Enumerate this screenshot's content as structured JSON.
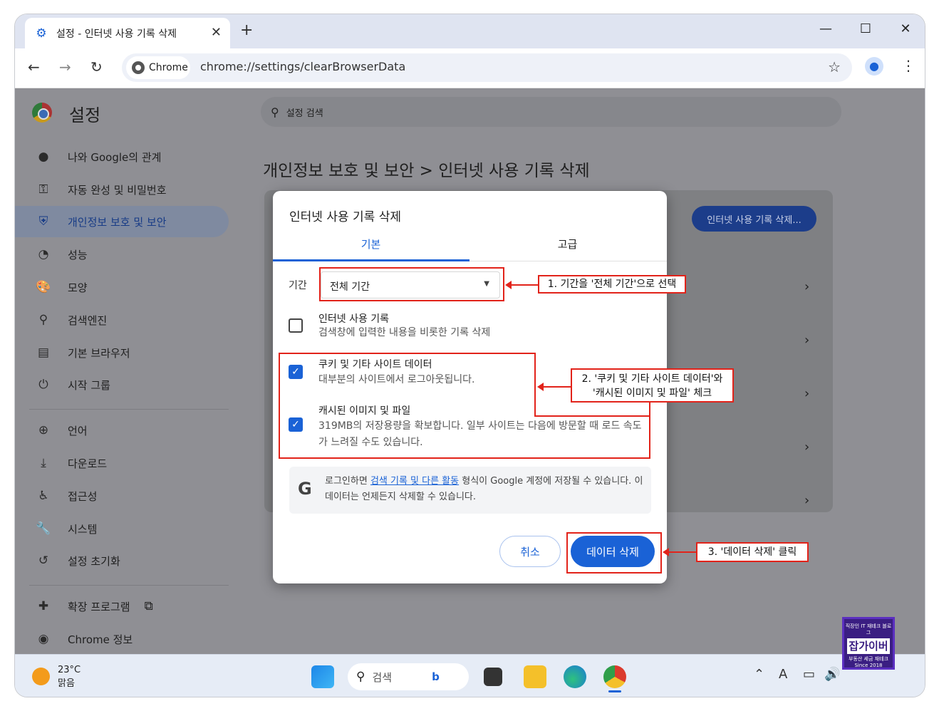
{
  "browser": {
    "tab_title": "설정 - 인터넷 사용 기록 삭제",
    "chip_label": "Chrome",
    "url": "chrome://settings/clearBrowserData"
  },
  "settings": {
    "title": "설정",
    "search_placeholder": "설정 검색",
    "breadcrumb": "개인정보 보호 및 보안  >  인터넷 사용 기록 삭제",
    "bg_button": "인터넷 사용 기록 삭제...",
    "sidebar": [
      {
        "label": "나와 Google의 관계",
        "icon": "person-icon"
      },
      {
        "label": "자동 완성 및 비밀번호",
        "icon": "key-icon"
      },
      {
        "label": "개인정보 보호 및 보안",
        "icon": "shield-icon",
        "active": true
      },
      {
        "label": "성능",
        "icon": "speedometer-icon"
      },
      {
        "label": "모양",
        "icon": "palette-icon"
      },
      {
        "label": "검색엔진",
        "icon": "search-icon"
      },
      {
        "label": "기본 브라우저",
        "icon": "browser-icon"
      },
      {
        "label": "시작 그룹",
        "icon": "power-icon"
      },
      {
        "label": "언어",
        "icon": "globe-icon"
      },
      {
        "label": "다운로드",
        "icon": "download-icon"
      },
      {
        "label": "접근성",
        "icon": "accessibility-icon"
      },
      {
        "label": "시스템",
        "icon": "wrench-icon"
      },
      {
        "label": "설정 초기화",
        "icon": "reset-icon"
      },
      {
        "label": "확장 프로그램",
        "icon": "puzzle-icon"
      },
      {
        "label": "Chrome 정보",
        "icon": "chrome-icon"
      }
    ]
  },
  "dialog": {
    "title": "인터넷 사용 기록 삭제",
    "tab_basic": "기본",
    "tab_advanced": "고급",
    "period_label": "기간",
    "period_value": "전체 기간",
    "items": [
      {
        "title": "인터넷 사용 기록",
        "desc": "검색창에 입력한 내용을 비롯한 기록 삭제",
        "checked": false
      },
      {
        "title": "쿠키 및 기타 사이트 데이터",
        "desc": "대부분의 사이트에서 로그아웃됩니다.",
        "checked": true
      },
      {
        "title": "캐시된 이미지 및 파일",
        "desc": "319MB의 저장용량을 확보합니다. 일부 사이트는 다음에 방문할 때 로드 속도가 느려질 수도 있습니다.",
        "checked": true
      }
    ],
    "google_note_pre": "로그인하면 ",
    "google_note_link": "검색 기록 및 다른 활동",
    "google_note_post": " 형식이 Google 계정에 저장될 수 있습니다. 이 데이터는 언제든지 삭제할 수 있습니다.",
    "cancel_label": "취소",
    "delete_label": "데이터 삭제"
  },
  "annotations": {
    "step1": "1. 기간을 '전체 기간'으로 선택",
    "step2_line1": "2. '쿠키 및 기타 사이트 데이터'와",
    "step2_line2": "'캐시된 이미지 및 파일' 체크",
    "step3": "3. '데이터 삭제' 클릭"
  },
  "taskbar": {
    "temp": "23°C",
    "weather": "맑음",
    "search_label": "검색"
  },
  "badge": {
    "top": "직장인 IT 재테크 블로그",
    "main": "잡가이버",
    "sub": "부동산 세금 재테크",
    "since": "Since 2018"
  },
  "colors": {
    "accent": "#1a62d6",
    "annotation": "#e2231a"
  }
}
